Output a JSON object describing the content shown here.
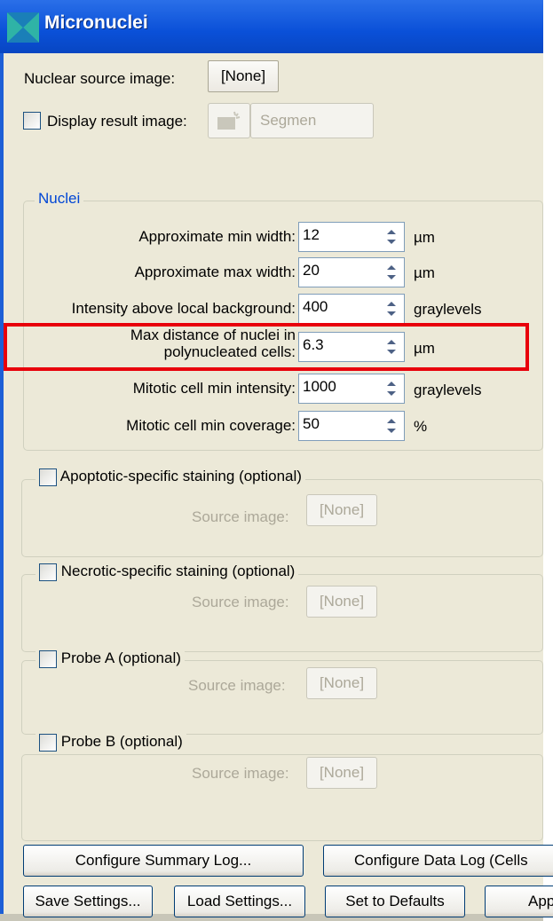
{
  "window": {
    "title": "Micronuclei"
  },
  "top": {
    "nuclear_source_label": "Nuclear source image:",
    "nuclear_source_button": "[None]",
    "display_result_label": "Display result image:",
    "segment_button": "Segmen"
  },
  "nuclei": {
    "group_title": "Nuclei",
    "params": [
      {
        "label": "Approximate min width:",
        "value": "12",
        "unit": "µm"
      },
      {
        "label": "Approximate max width:",
        "value": "20",
        "unit": "µm"
      },
      {
        "label": "Intensity above local background:",
        "value": "400",
        "unit": "graylevels"
      },
      {
        "label_line1": "Max distance of nuclei in",
        "label_line2": "polynucleated cells:",
        "value": "6.3",
        "unit": "µm"
      },
      {
        "label": "Mitotic cell min intensity:",
        "value": "1000",
        "unit": "graylevels"
      },
      {
        "label": "Mitotic cell min coverage:",
        "value": "50",
        "unit": "%"
      }
    ]
  },
  "optional_groups": [
    {
      "title": "Apoptotic-specific staining (optional)",
      "source_label": "Source image:",
      "source_button": "[None]"
    },
    {
      "title": "Necrotic-specific staining (optional)",
      "source_label": "Source image:",
      "source_button": "[None]"
    },
    {
      "title": "Probe A (optional)",
      "source_label": "Source image:",
      "source_button": "[None]"
    },
    {
      "title": "Probe B (optional)",
      "source_label": "Source image:",
      "source_button": "[None]"
    }
  ],
  "buttons": {
    "configure_summary_log": "Configure Summary Log...",
    "configure_data_log": "Configure Data Log (Cells",
    "save_settings": "Save Settings...",
    "load_settings": "Load Settings...",
    "set_to_defaults": "Set to Defaults",
    "apply": "App"
  },
  "colors": {
    "highlight": "#e8000b",
    "group_title_accent": "#0046d5",
    "titlebar": "#0a50d8"
  }
}
